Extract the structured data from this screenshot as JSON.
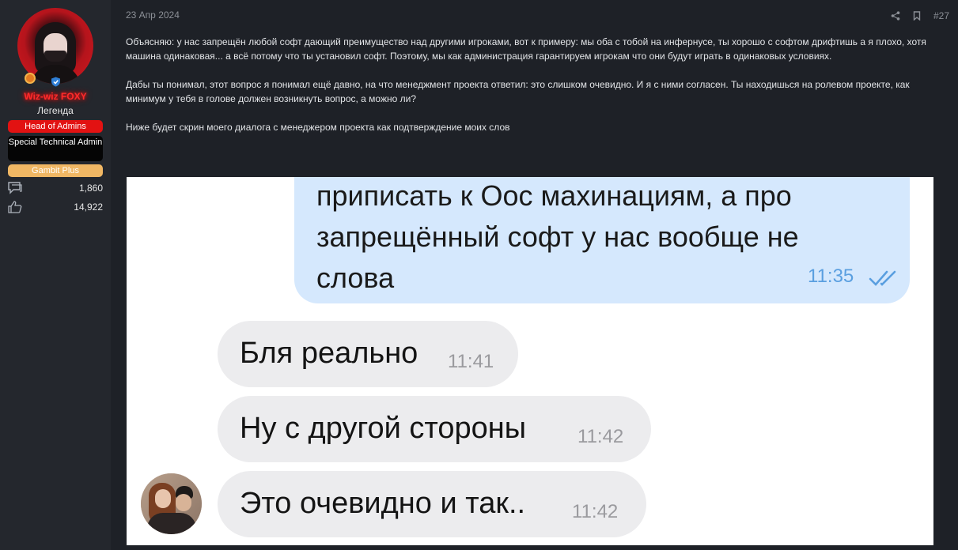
{
  "user": {
    "name": "Wiz-wiz FOXY",
    "title": "Легенда",
    "banners": [
      "Head of Admins",
      "Special Technical Admin",
      "Gambit Plus"
    ],
    "messages_count": "1,860",
    "reactions_count": "14,922",
    "icons": [
      "medal-icon",
      "shield-icon",
      "messages-icon",
      "thumbs-up-icon"
    ]
  },
  "post": {
    "date": "23 Апр 2024",
    "number": "#27",
    "paragraphs": [
      "Объясняю: у нас запрещён любой софт дающий преимущество над другими игроками, вот к примеру: мы оба с тобой на инфернусе, ты хорошо с софтом дрифтишь а я плохо, хотя машина одинаковая... а всё потому что ты установил софт. Поэтому, мы как администрация гарантируем игрокам что они будут играть в одинаковых условиях.",
      "Дабы ты понимал, этот вопрос я понимал ещё давно, на что менеджмент проекта ответил: это слишком очевидно. И я с ними согласен. Ты находишься на ролевом проекте, как минимум у тебя в голове должен возникнуть вопрос, а можно ли?",
      "Ниже будет скрин моего диалога с менеджером проекта как подтверждение моих слов"
    ]
  },
  "chat": {
    "outgoing": {
      "text_lines": [
        "приписать к Оос махинациям, а про",
        "запрещённый софт у нас вообще не",
        "слова"
      ],
      "time": "11:35"
    },
    "incoming": [
      {
        "text": "Бля реально",
        "time": "11:41"
      },
      {
        "text": "Ну с другой стороны",
        "time": "11:42"
      },
      {
        "text": "Это очевидно и так..",
        "time": "11:42"
      }
    ]
  },
  "colors": {
    "page_bg": "#1e2127",
    "sidebar_bg": "#24272d",
    "username": "#ff2b2b",
    "head_banner": "#e21212",
    "tech_banner": "#050505",
    "gambit_banner": "#f0b764",
    "outgoing_bubble": "#d5e8fd",
    "incoming_bubble": "#ececee"
  }
}
